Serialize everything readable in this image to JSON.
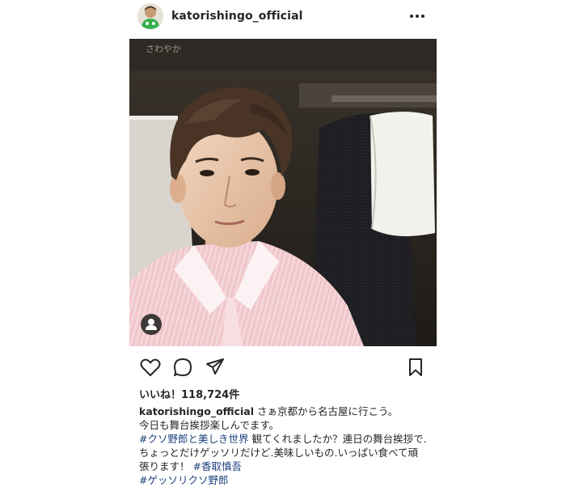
{
  "post": {
    "username": "katorishingo_official",
    "photo_overlay_text": "さわやか"
  },
  "likes": {
    "label": "いいね！118,724件"
  },
  "caption": {
    "username": "katorishingo_official",
    "line1": "さぁ京都から名古屋に行こう。",
    "line2": "今日も舞台挨拶楽しんでます。",
    "hashtag1": "#クソ野郎と美しき世界",
    "line3_rest": "観てくれましたか？連日の舞台挨拶で.",
    "line4": "ちょっとだけゲッソリだけど.美味しいもの.いっぱい食べて頑",
    "line5_text": "張ります！",
    "hashtag2": "#香取慎吾",
    "hashtag3": "#ゲッソリクソ野郎"
  },
  "icons": {
    "more": "more-options-icon",
    "like": "heart-icon",
    "comment": "comment-icon",
    "share": "paper-plane-icon",
    "save": "bookmark-icon",
    "tag": "user-tag-icon"
  },
  "colors": {
    "text": "#262626",
    "hashtag": "#1b3f7a",
    "background": "#ffffff"
  }
}
